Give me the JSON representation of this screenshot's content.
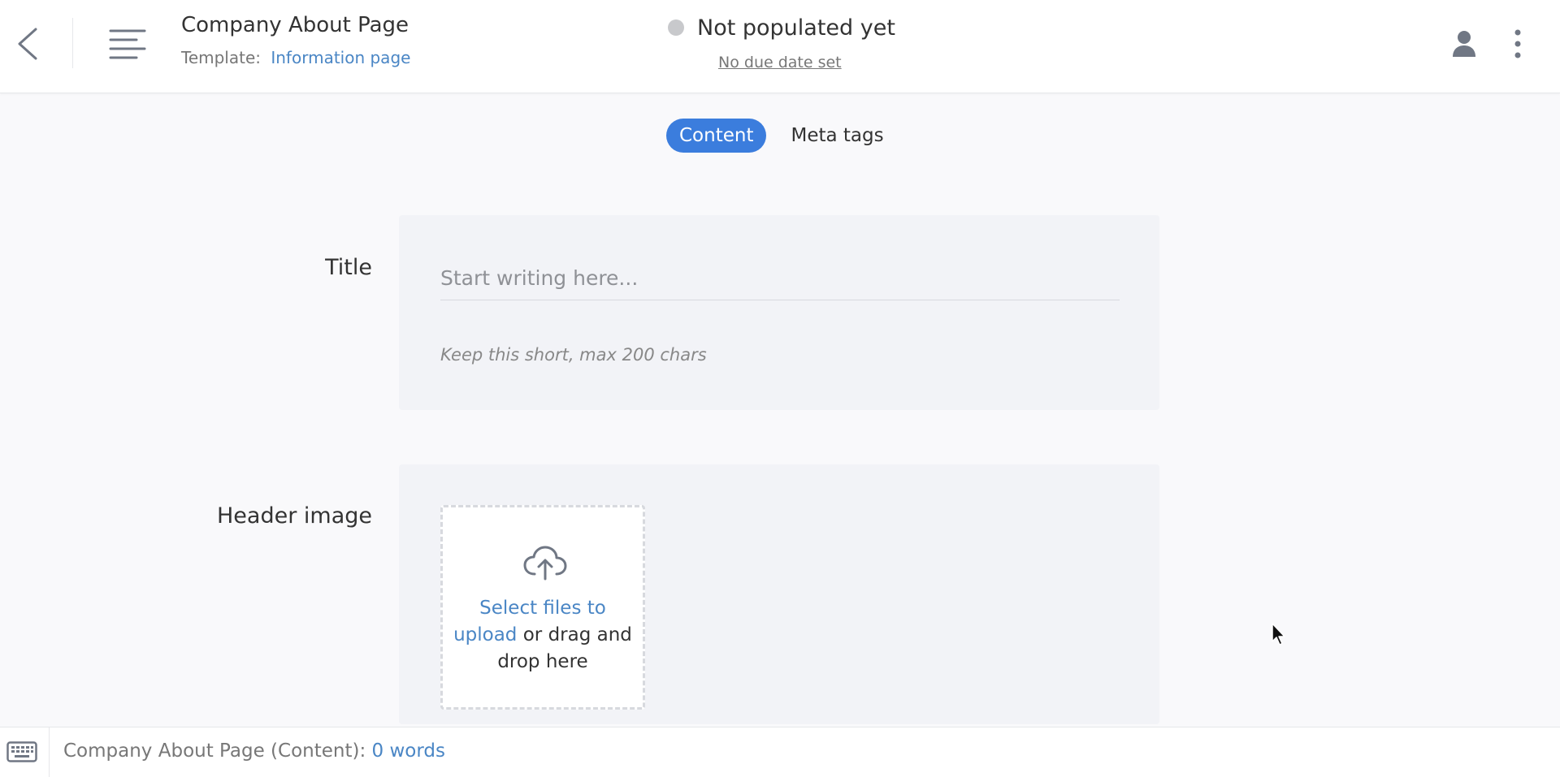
{
  "header": {
    "back_icon": "chevron-left-icon",
    "menu_icon": "text-lines-icon",
    "doc_title": "Company About Page",
    "template_label": "Template:",
    "template_name": "Information page",
    "status_text": "Not populated yet",
    "status_color": "#c8c9cc",
    "due_date_text": "No due date set",
    "user_icon": "person-icon",
    "more_icon": "vertical-dots-icon"
  },
  "tabs": [
    {
      "label": "Content",
      "active": true
    },
    {
      "label": "Meta tags",
      "active": false
    }
  ],
  "fields": {
    "title": {
      "label": "Title",
      "value": "",
      "placeholder": "Start writing here...",
      "hint": "Keep this short, max 200 chars"
    },
    "header_image": {
      "label": "Header image",
      "upload_icon": "cloud-upload-icon",
      "select_text": "Select files to upload",
      "drop_text": " or drag and drop here"
    }
  },
  "footer": {
    "keyboard_icon": "keyboard-icon",
    "word_count_label": "Company About Page (Content):",
    "word_count_value": "0 words"
  },
  "colors": {
    "accent": "#3b7ddd",
    "link": "#4a86c5",
    "panel": "#f2f3f7",
    "background": "#f9f9fb"
  }
}
